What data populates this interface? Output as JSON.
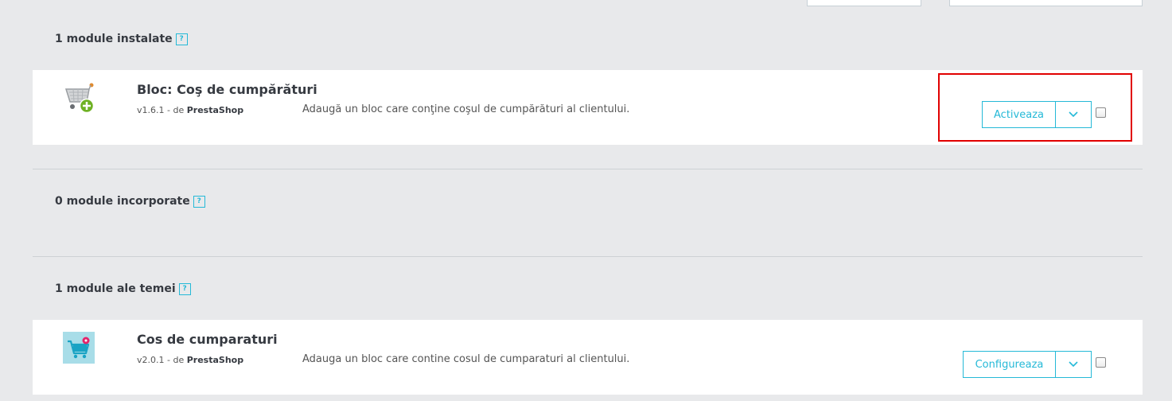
{
  "top_fields": [
    {
      "name": "filter-input-1",
      "value": ""
    },
    {
      "name": "filter-input-2",
      "value": ""
    }
  ],
  "sections": {
    "installed": {
      "title": "1 module instalate",
      "help": "?"
    },
    "builtin": {
      "title": "0 module incorporate",
      "help": "?"
    },
    "theme": {
      "title": "1 module ale temei",
      "help": "?"
    }
  },
  "modules": [
    {
      "name": "Bloc: Coş de cumpărături",
      "version_prefix": "v1.6.1 - de ",
      "author": "PrestaShop",
      "description": "Adaugă un bloc care conţine coşul de cumpărături al clientului.",
      "action_label": "Activeaza",
      "icon": "cart-add-icon"
    },
    {
      "name": "Cos de cumparaturi",
      "version_prefix": "v2.0.1 - de ",
      "author": "PrestaShop",
      "description": "Adauga un bloc care contine cosul de cumparaturi al clientului.",
      "action_label": "Configureaza",
      "icon": "cart-theme-icon"
    }
  ],
  "colors": {
    "accent": "#25b9d7",
    "highlight": "#e10000",
    "background": "#e8e9eb"
  }
}
